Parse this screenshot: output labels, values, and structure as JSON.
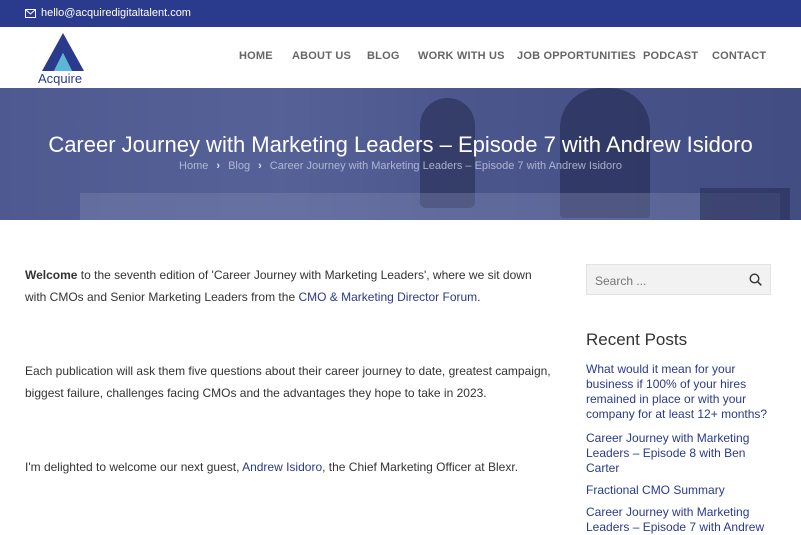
{
  "topbar": {
    "email": "hello@acquiredigitaltalent.com"
  },
  "logo": {
    "text": "Acquire"
  },
  "nav": {
    "items": [
      "HOME",
      "ABOUT US",
      "BLOG",
      "WORK WITH US",
      "JOB OPPORTUNITIES",
      "PODCAST",
      "CONTACT"
    ]
  },
  "hero": {
    "title": "Career Journey with Marketing Leaders – Episode 7 with Andrew Isidoro",
    "breadcrumb": [
      "Home",
      "Blog",
      "Career Journey with Marketing Leaders – Episode 7 with Andrew Isidoro"
    ]
  },
  "article": {
    "p1_bold": "Welcome",
    "p1_text": " to the seventh edition of 'Career Journey with Marketing Leaders', where we sit down with CMOs and Senior Marketing Leaders from the ",
    "p1_link": "CMO & Marketing Director Forum",
    "p1_end": ".",
    "p2": "Each publication will ask them five questions about their career journey to date, greatest campaign, biggest failure, challenges facing CMOs and the advantages they hope to take in 2023.",
    "p3_text": "I'm delighted to welcome our next guest, ",
    "p3_link": "Andrew Isidoro",
    "p3_end": ", the Chief Marketing Officer at Blexr."
  },
  "sidebar": {
    "search_placeholder": "Search ...",
    "recent_title": "Recent Posts",
    "recent_posts": [
      "What would it mean for your business if 100% of your hires remained in place or with your company for at least 12+ months?",
      "Career Journey with Marketing Leaders – Episode 8 with Ben Carter",
      "Fractional CMO Summary",
      "Career Journey with Marketing Leaders – Episode 7 with Andrew"
    ]
  },
  "colors": {
    "brand": "#2a3a8c",
    "link": "#2a3a8c"
  }
}
